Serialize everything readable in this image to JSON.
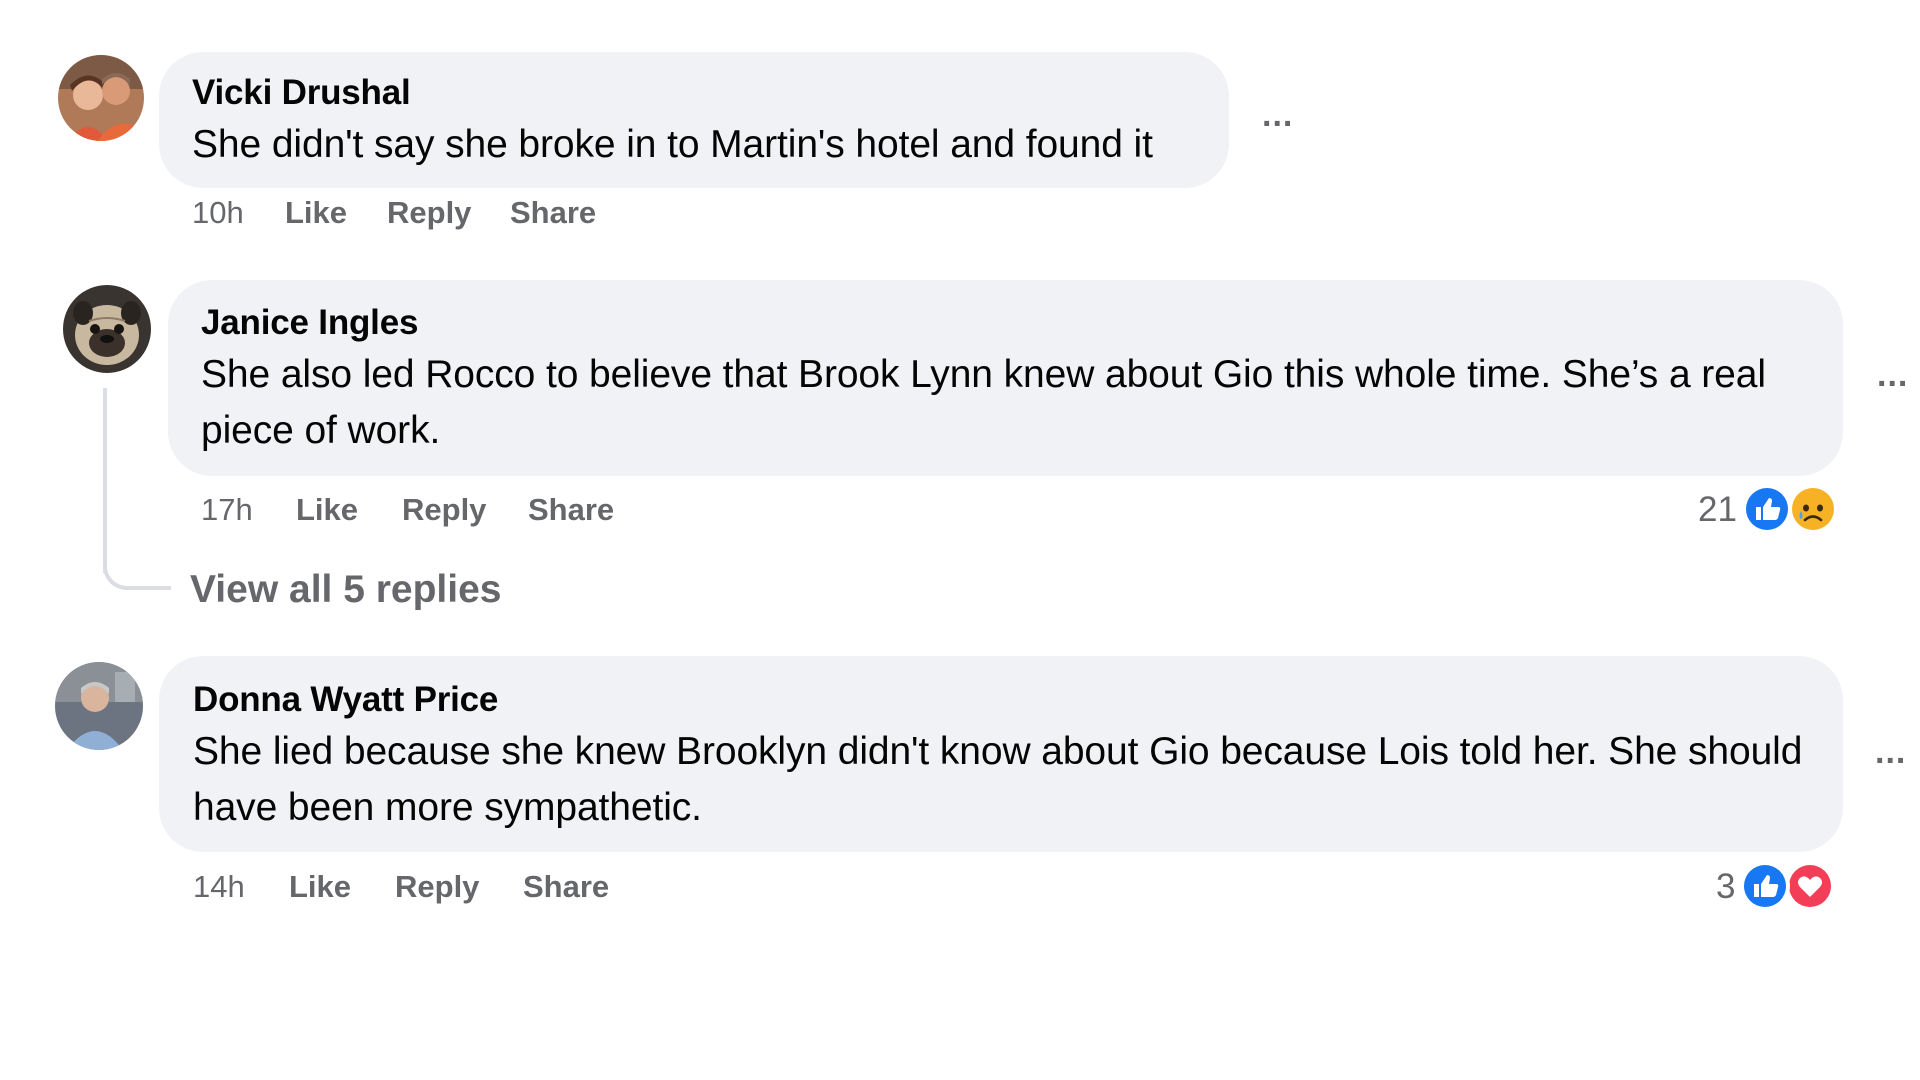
{
  "comments": [
    {
      "author": "Vicki Drushal",
      "text": "She didn't say she broke in to Martin's hotel and found it",
      "time": "10h",
      "like_label": "Like",
      "reply_label": "Reply",
      "share_label": "Share",
      "more_label": "...",
      "avatar_icon": "avatar-photo-couple"
    },
    {
      "author": "Janice Ingles",
      "text": "She also led Rocco to believe that Brook Lynn knew about Gio this whole time. She’s a real piece of work.",
      "time": "17h",
      "like_label": "Like",
      "reply_label": "Reply",
      "share_label": "Share",
      "more_label": "...",
      "reaction_count": "21",
      "reaction_icons": [
        "like-icon",
        "sad-icon"
      ],
      "view_replies_label": "View all 5 replies",
      "avatar_icon": "avatar-photo-pug"
    },
    {
      "author": "Donna Wyatt Price",
      "text": "She lied because she knew Brooklyn didn't know about Gio because Lois told her. She should have been more sympathetic.",
      "time": "14h",
      "like_label": "Like",
      "reply_label": "Reply",
      "share_label": "Share",
      "more_label": "...",
      "reaction_count": "3",
      "reaction_icons": [
        "like-icon",
        "love-icon"
      ],
      "avatar_icon": "avatar-photo-person"
    }
  ],
  "colors": {
    "bubble_bg": "#f0f2f5",
    "secondary_text": "#65676b",
    "primary_text": "#050505",
    "like_blue": "#1877f2",
    "love_red": "#f33e58",
    "sad_yellow": "#f7b125",
    "thread_line": "#dadde1"
  }
}
